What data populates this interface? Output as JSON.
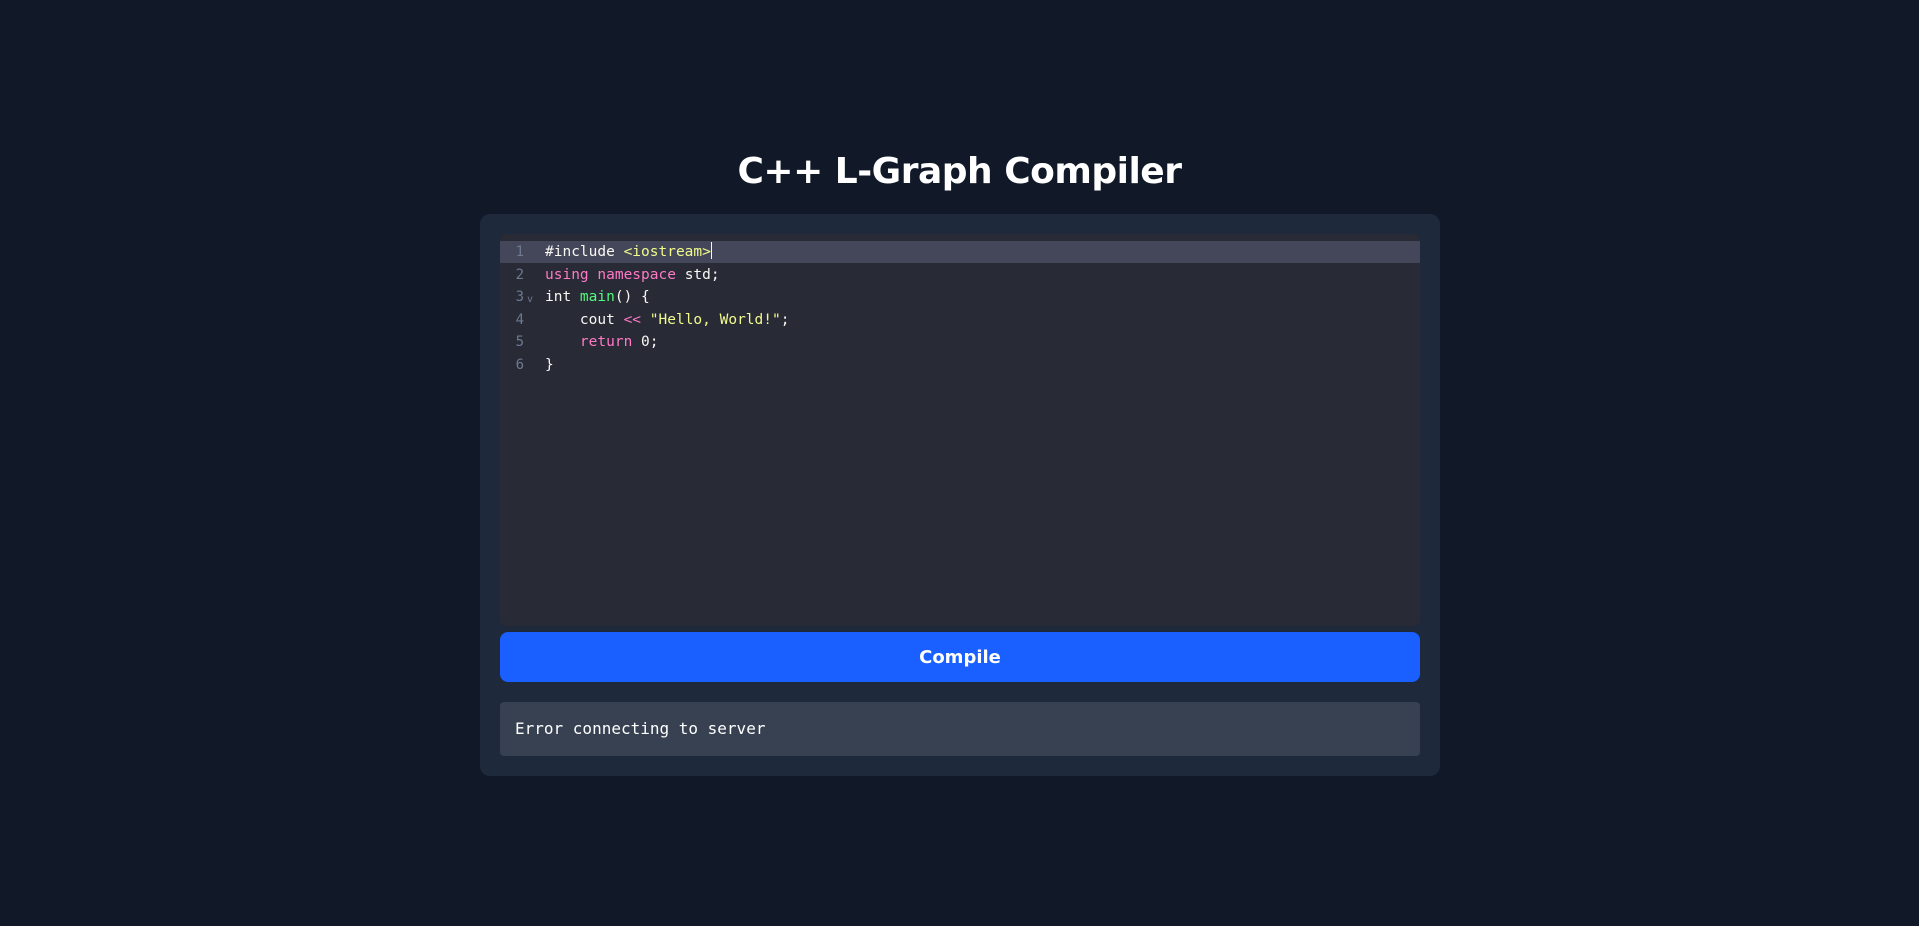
{
  "page": {
    "title": "C++ L-Graph Compiler"
  },
  "editor": {
    "theme_colors": {
      "background": "#282a36",
      "active_line": "#44475a",
      "keyword": "#ff79c6",
      "string": "#f1fa8c",
      "function": "#50fa7b",
      "text": "#f8f8f2"
    },
    "lines": [
      {
        "number": "1",
        "fold": "",
        "active": true,
        "tokens": [
          {
            "text": "#include ",
            "type": "plain"
          },
          {
            "text": "<iostream>",
            "type": "string"
          }
        ]
      },
      {
        "number": "2",
        "fold": "",
        "active": false,
        "tokens": [
          {
            "text": "using",
            "type": "keyword"
          },
          {
            "text": " ",
            "type": "plain"
          },
          {
            "text": "namespace",
            "type": "keyword"
          },
          {
            "text": " std;",
            "type": "plain"
          }
        ]
      },
      {
        "number": "3",
        "fold": "v",
        "active": false,
        "tokens": [
          {
            "text": "int ",
            "type": "plain"
          },
          {
            "text": "main",
            "type": "function"
          },
          {
            "text": "() {",
            "type": "plain"
          }
        ]
      },
      {
        "number": "4",
        "fold": "",
        "active": false,
        "tokens": [
          {
            "text": "    cout ",
            "type": "plain"
          },
          {
            "text": "<<",
            "type": "operator"
          },
          {
            "text": " ",
            "type": "plain"
          },
          {
            "text": "\"Hello, World!\"",
            "type": "string"
          },
          {
            "text": ";",
            "type": "plain"
          }
        ]
      },
      {
        "number": "5",
        "fold": "",
        "active": false,
        "tokens": [
          {
            "text": "    ",
            "type": "plain"
          },
          {
            "text": "return",
            "type": "keyword"
          },
          {
            "text": " 0;",
            "type": "plain"
          }
        ]
      },
      {
        "number": "6",
        "fold": "",
        "active": false,
        "tokens": [
          {
            "text": "}",
            "type": "plain"
          }
        ]
      }
    ]
  },
  "compile_button": {
    "label": "Compile",
    "color": "#1a5fff"
  },
  "output": {
    "text": "Error connecting to server"
  }
}
